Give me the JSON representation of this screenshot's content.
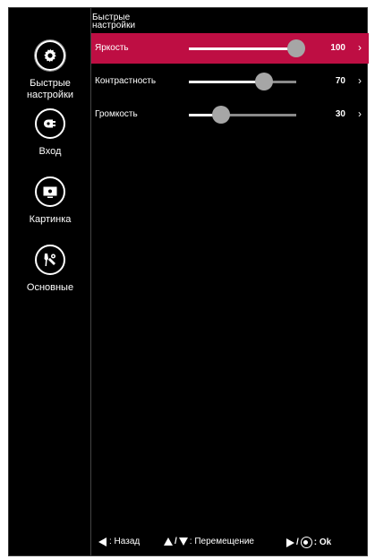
{
  "sidebar": {
    "items": [
      {
        "label": "Быстрые\nнастройки",
        "icon": "gear-icon",
        "active": true
      },
      {
        "label": "Вход",
        "icon": "input-plug-icon",
        "active": false
      },
      {
        "label": "Картинка",
        "icon": "picture-monitor-icon",
        "active": false
      },
      {
        "label": "Основные",
        "icon": "general-tools-icon",
        "active": false
      }
    ]
  },
  "header": {
    "title": "Быстрые настройки"
  },
  "settings": {
    "rows": [
      {
        "label": "Яркость",
        "value": "100",
        "level": 100,
        "active": true
      },
      {
        "label": "Контрастность",
        "value": "70",
        "level": 70,
        "active": false
      },
      {
        "label": "Громкость",
        "value": "30",
        "level": 30,
        "active": false
      }
    ],
    "arrow": "›"
  },
  "footer": {
    "back_label": ": Назад",
    "move_separator": "/",
    "move_label": ": Перемещение",
    "ok_separator": "/",
    "ok_label": ": Ok"
  },
  "colors": {
    "accent": "#be0e43",
    "background": "#000000",
    "knob": "#a6a6a6",
    "track": "#8a8a8a"
  }
}
